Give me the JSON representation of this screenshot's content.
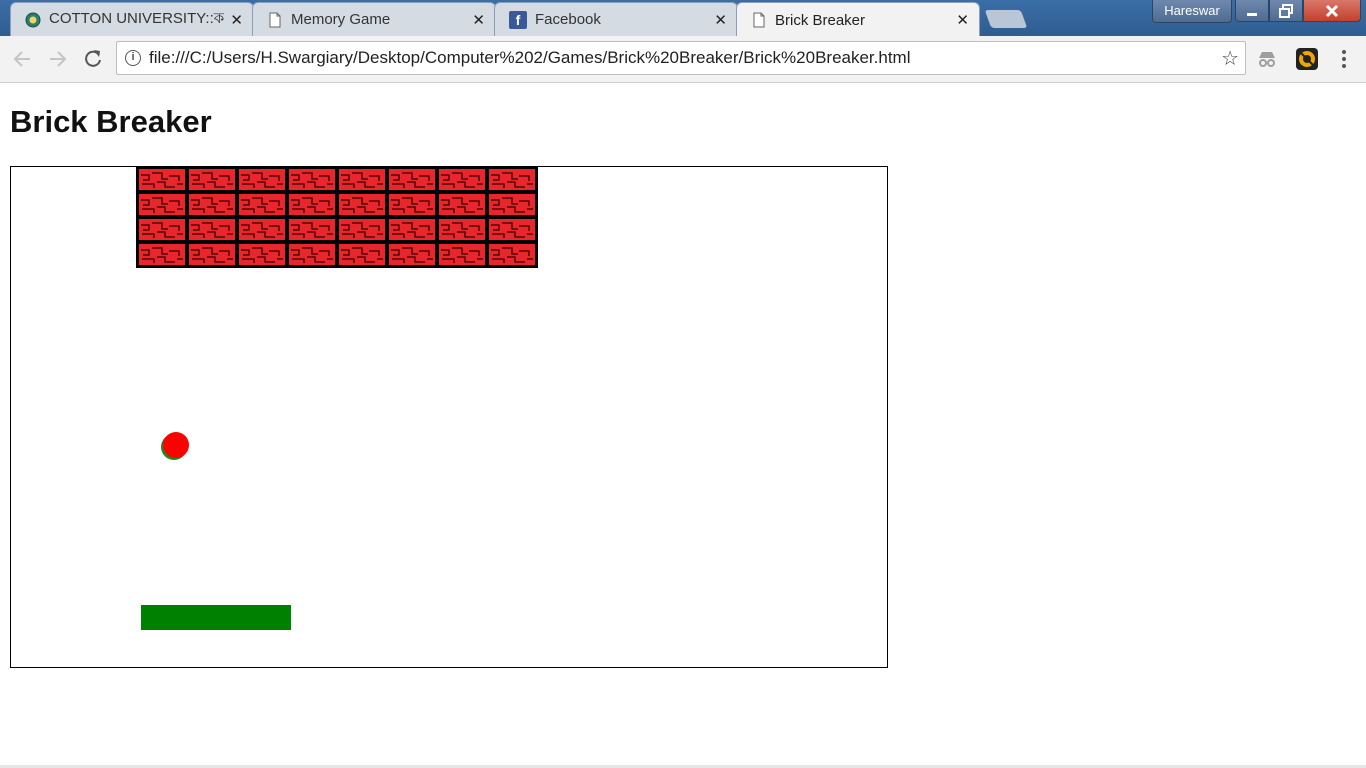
{
  "browser": {
    "tabs": [
      {
        "title": "COTTON UNIVERSITY::কট",
        "active": false,
        "icon": "university-seal-icon"
      },
      {
        "title": "Memory Game",
        "active": false,
        "icon": "document-icon"
      },
      {
        "title": "Facebook",
        "active": false,
        "icon": "facebook-icon"
      },
      {
        "title": "Brick Breaker",
        "active": true,
        "icon": "document-icon"
      }
    ],
    "tab_close_glyph": "✕",
    "profile_name": "Hareswar",
    "url": "file:///C:/Users/H.Swargiary/Desktop/Computer%202/Games/Brick%20Breaker/Brick%20Breaker.html"
  },
  "page": {
    "title": "Brick Breaker"
  },
  "game": {
    "brick_rows": 4,
    "brick_cols": 8,
    "brick_color": "#e8262b",
    "brick_outline_color": "#000000",
    "ball_color": "#ff0000",
    "ball_shadow_color": "#1e8a1e",
    "paddle_color": "#008000"
  }
}
